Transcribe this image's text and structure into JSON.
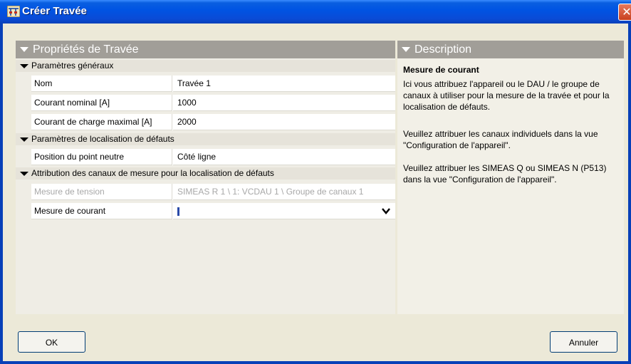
{
  "window": {
    "title": "Créer Travée",
    "close_label": "✕"
  },
  "left_panel": {
    "header": "Propriétés de Travée",
    "sections": [
      {
        "title": "Paramètres généraux",
        "rows": [
          {
            "label": "Nom",
            "value": "Travée 1"
          },
          {
            "label": "Courant nominal [A]",
            "value": "1000"
          },
          {
            "label": "Courant de charge maximal [A]",
            "value": "2000"
          }
        ]
      },
      {
        "title": "Paramètres de localisation de défauts",
        "rows": [
          {
            "label": "Position du point neutre",
            "value": "Côté ligne"
          }
        ]
      },
      {
        "title": "Attribution des canaux de mesure pour la localisation de défauts",
        "rows": [
          {
            "label": "Mesure de tension",
            "value": "SIMEAS R 1 \\ 1: VCDAU 1 \\ Groupe de canaux 1",
            "disabled": true
          },
          {
            "label": "Mesure de courant",
            "value": ""
          }
        ]
      }
    ]
  },
  "right_panel": {
    "header": "Description",
    "title": "Mesure de courant",
    "paragraphs": [
      "Ici vous attribuez l'appareil ou le DAU / le groupe de canaux à utiliser pour la mesure de la travée et pour la localisation de défauts.",
      "Veuillez attribuer les canaux individuels dans la vue \"Configuration de l'appareil\".",
      "Veuillez attribuer les SIMEAS Q ou SIMEAS N (P513) dans la vue \"Configuration de l'appareil\"."
    ]
  },
  "buttons": {
    "ok": "OK",
    "cancel": "Annuler"
  }
}
